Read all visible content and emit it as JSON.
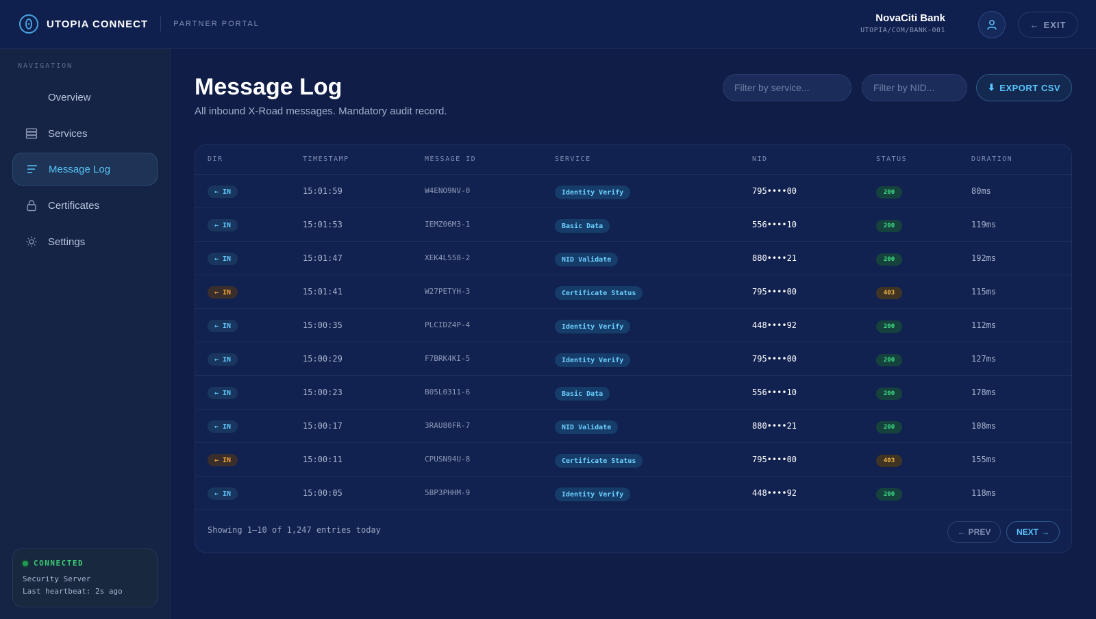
{
  "header": {
    "brand": "UTOPIA CONNECT",
    "portal": "PARTNER PORTAL",
    "account_name": "NovaCiti Bank",
    "account_id": "UTOPIA/COM/BANK-001",
    "exit_label": "EXIT"
  },
  "sidebar": {
    "title": "NAVIGATION",
    "items": [
      {
        "label": "Overview",
        "icon": "grid-icon"
      },
      {
        "label": "Services",
        "icon": "server-stack-icon"
      },
      {
        "label": "Message Log",
        "icon": "lines-icon",
        "active": true
      },
      {
        "label": "Certificates",
        "icon": "lock-icon"
      },
      {
        "label": "Settings",
        "icon": "gear-icon"
      }
    ],
    "status": {
      "label": "CONNECTED",
      "line1": "Security Server",
      "line2": "Last heartbeat: 2s ago"
    }
  },
  "main": {
    "title": "Message Log",
    "subtitle": "All inbound X-Road messages. Mandatory audit record.",
    "filter_service_placeholder": "Filter by service...",
    "filter_nid_placeholder": "Filter by NID...",
    "export_label": "EXPORT CSV"
  },
  "table": {
    "columns": [
      "DIR",
      "TIMESTAMP",
      "MESSAGE ID",
      "SERVICE",
      "NID",
      "STATUS",
      "DURATION"
    ],
    "rows": [
      {
        "dir": "← IN",
        "ts": "15:01:59",
        "id": "W4ENO9NV-0",
        "service": "Identity Verify",
        "nid": "795••••00",
        "status": "200",
        "duration": "80ms"
      },
      {
        "dir": "← IN",
        "ts": "15:01:53",
        "id": "IEMZ06M3-1",
        "service": "Basic Data",
        "nid": "556••••10",
        "status": "200",
        "duration": "119ms"
      },
      {
        "dir": "← IN",
        "ts": "15:01:47",
        "id": "XEK4L558-2",
        "service": "NID Validate",
        "nid": "880••••21",
        "status": "200",
        "duration": "192ms"
      },
      {
        "dir": "← IN",
        "ts": "15:01:41",
        "id": "W27PETYH-3",
        "service": "Certificate Status",
        "nid": "795••••00",
        "status": "403",
        "duration": "115ms"
      },
      {
        "dir": "← IN",
        "ts": "15:00:35",
        "id": "PLCIDZ4P-4",
        "service": "Identity Verify",
        "nid": "448••••92",
        "status": "200",
        "duration": "112ms"
      },
      {
        "dir": "← IN",
        "ts": "15:00:29",
        "id": "F7BRK4KI-5",
        "service": "Identity Verify",
        "nid": "795••••00",
        "status": "200",
        "duration": "127ms"
      },
      {
        "dir": "← IN",
        "ts": "15:00:23",
        "id": "B05L0311-6",
        "service": "Basic Data",
        "nid": "556••••10",
        "status": "200",
        "duration": "178ms"
      },
      {
        "dir": "← IN",
        "ts": "15:00:17",
        "id": "3RAU80FR-7",
        "service": "NID Validate",
        "nid": "880••••21",
        "status": "200",
        "duration": "108ms"
      },
      {
        "dir": "← IN",
        "ts": "15:00:11",
        "id": "CPUSN94U-8",
        "service": "Certificate Status",
        "nid": "795••••00",
        "status": "403",
        "duration": "155ms"
      },
      {
        "dir": "← IN",
        "ts": "15:00:05",
        "id": "5BP3PHHM-9",
        "service": "Identity Verify",
        "nid": "448••••92",
        "status": "200",
        "duration": "118ms"
      }
    ],
    "footer": "Showing 1–10 of 1,247 entries today",
    "prev_label": "PREV",
    "next_label": "NEXT"
  },
  "colors": {
    "accent": "#5cc6ff",
    "ok": "#3ddc84",
    "warn": "#f2a43a",
    "background": "#0f1d47"
  }
}
